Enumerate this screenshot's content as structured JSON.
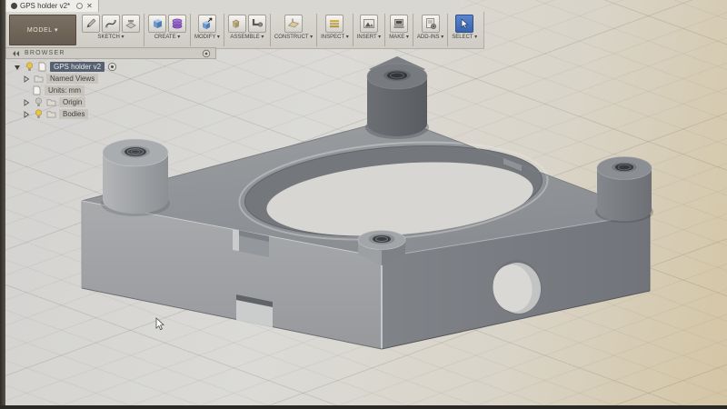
{
  "tab": {
    "title": "GPS holder v2*",
    "close_label": "✕"
  },
  "toolbar": {
    "model_label": "MODEL ▾",
    "groups": [
      {
        "label": "SKETCH ▾",
        "icons": [
          "pencil-icon",
          "spline-icon",
          "sketch-slab-icon"
        ]
      },
      {
        "label": "CREATE ▾",
        "icons": [
          "solid-box-icon",
          "coil-icon"
        ]
      },
      {
        "label": "MODIFY ▾",
        "icons": [
          "press-pull-icon"
        ]
      },
      {
        "label": "ASSEMBLE ▾",
        "icons": [
          "new-component-icon",
          "joint-icon"
        ]
      },
      {
        "label": "CONSTRUCT ▾",
        "icons": [
          "construction-plane-icon"
        ]
      },
      {
        "label": "INSPECT ▾",
        "icons": [
          "measure-icon"
        ]
      },
      {
        "label": "INSERT ▾",
        "icons": [
          "insert-image-icon"
        ]
      },
      {
        "label": "MAKE ▾",
        "icons": [
          "make-icon"
        ]
      },
      {
        "label": "ADD-INS ▾",
        "icons": [
          "add-ins-icon"
        ]
      },
      {
        "label": "SELECT ▾",
        "icons": [
          "select-cursor-icon"
        ]
      }
    ]
  },
  "browser": {
    "header_label": "BROWSER",
    "items": [
      {
        "label": "GPS holder v2",
        "selected": true,
        "visibility": "on"
      },
      {
        "label": "Named Views"
      },
      {
        "label": "Units: mm"
      },
      {
        "label": "Origin",
        "visibility": "off"
      },
      {
        "label": "Bodies",
        "visibility": "on"
      }
    ]
  },
  "viewport": {
    "model_name": "GPS holder v2",
    "grid": "on"
  },
  "colors": {
    "select_highlight": "#3f6fbf",
    "bulb_on": "#e9c53f",
    "model_gray": "#8d9094",
    "canvas_tint": "#d4c5a3"
  }
}
